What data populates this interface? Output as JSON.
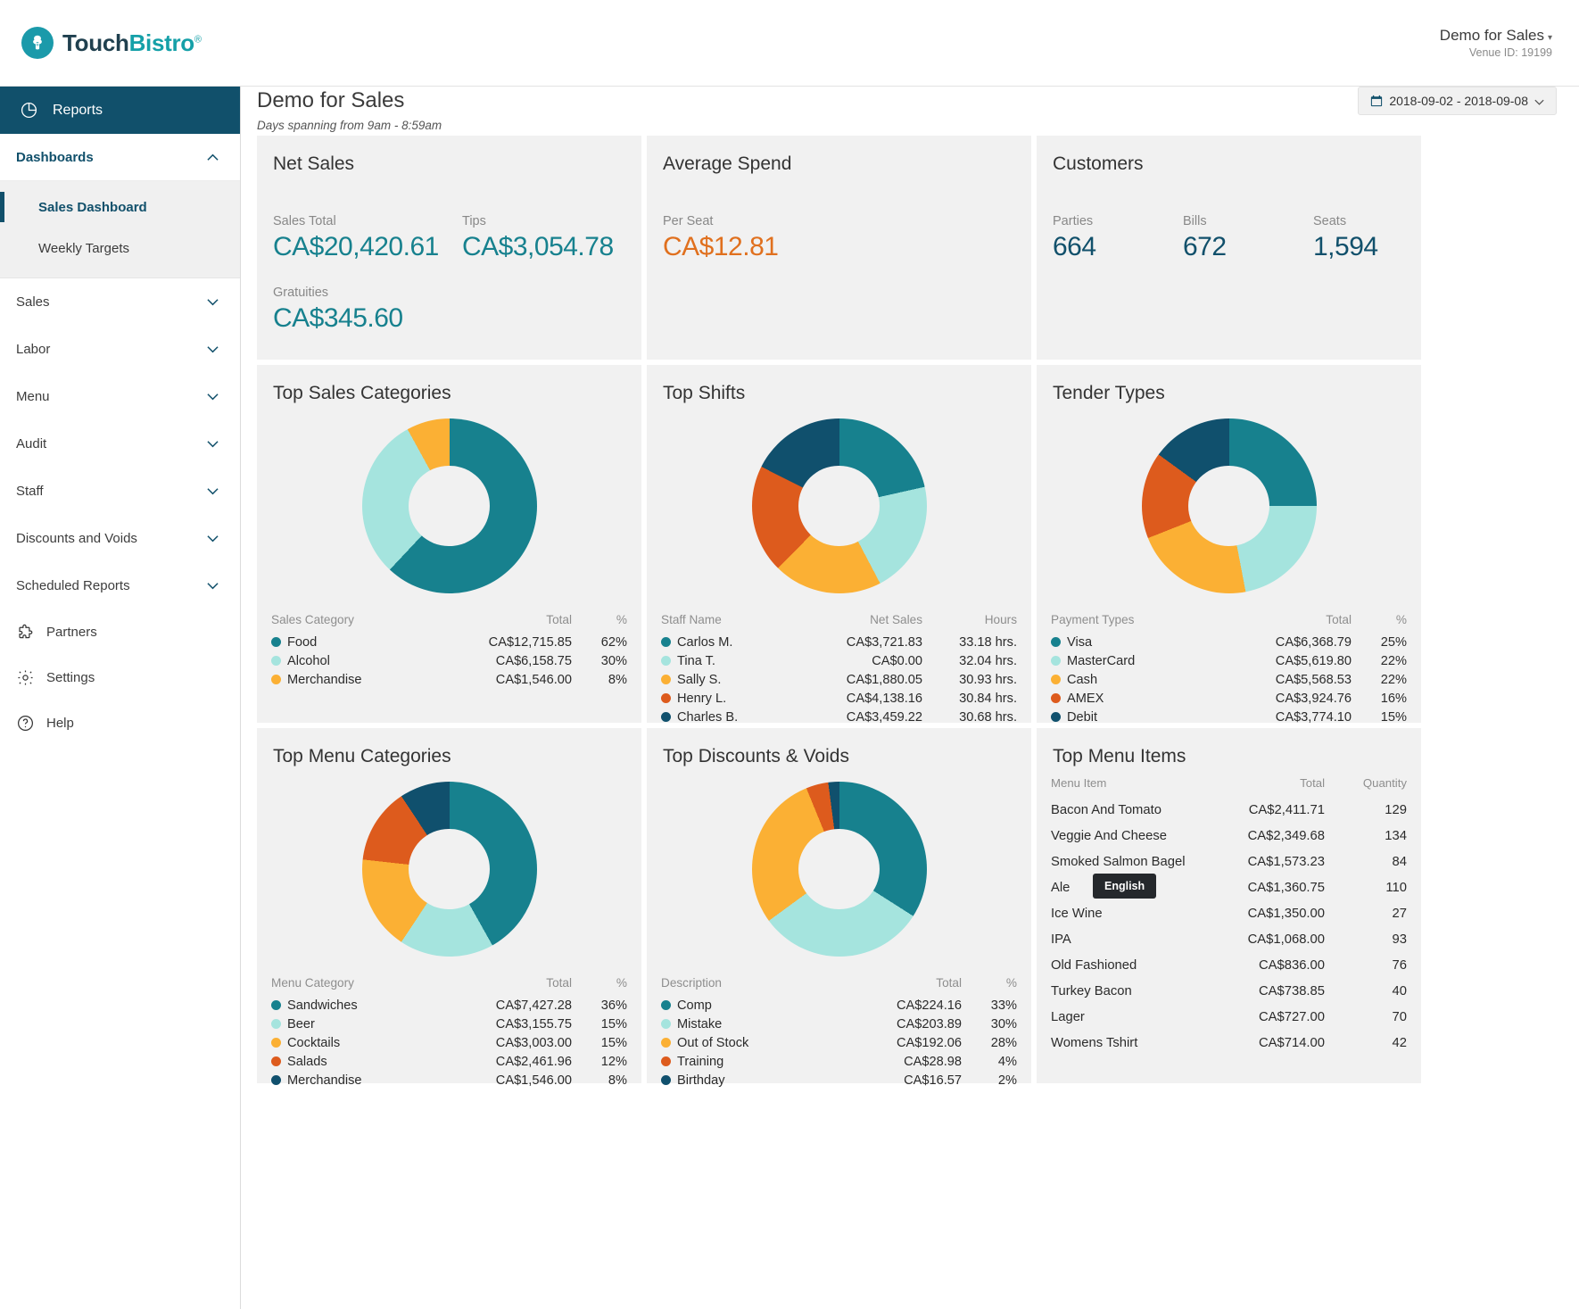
{
  "brand": {
    "name_part1": "Touch",
    "name_part2": "Bistro",
    "registered": "®",
    "logo_icon": "chef-hat-icon"
  },
  "header": {
    "venue_name": "Demo for Sales",
    "venue_caret": "▾",
    "venue_id": "Venue ID: 19199"
  },
  "sidebar": {
    "reports_label": "Reports",
    "reports_icon": "pie-chart-icon",
    "dashboards_label": "Dashboards",
    "dashboards_chevron": "⌃",
    "sub_items": [
      {
        "label": "Sales Dashboard",
        "active": true
      },
      {
        "label": "Weekly Targets",
        "active": false
      }
    ],
    "sections": [
      {
        "label": "Sales",
        "chevron": "⌄"
      },
      {
        "label": "Labor",
        "chevron": "⌄"
      },
      {
        "label": "Menu",
        "chevron": "⌄"
      },
      {
        "label": "Audit",
        "chevron": "⌄"
      },
      {
        "label": "Staff",
        "chevron": "⌄"
      },
      {
        "label": "Discounts and Voids",
        "chevron": "⌄"
      },
      {
        "label": "Scheduled Reports",
        "chevron": "⌄"
      }
    ],
    "utility": [
      {
        "label": "Partners",
        "icon": "puzzle-icon"
      },
      {
        "label": "Settings",
        "icon": "gear-icon"
      },
      {
        "label": "Help",
        "icon": "question-circle-icon"
      }
    ]
  },
  "page": {
    "title": "Demo for Sales",
    "subtitle": "Days spanning from 9am - 8:59am",
    "date_range": "2018-09-02 - 2018-09-08",
    "date_caret": "⌄",
    "calendar_icon": "calendar-icon"
  },
  "colors": {
    "teal": "#17818e",
    "light_cyan": "#a5e4de",
    "amber": "#fbb034",
    "orange": "#dd5b1d",
    "navy": "#10506d",
    "accent_orange_text": "#e0701e",
    "card_bg": "#f1f1f1",
    "sidebar_active": "#11506b"
  },
  "net_sales": {
    "title": "Net Sales",
    "sales_total_label": "Sales Total",
    "sales_total_value": "CA$20,420.61",
    "tips_label": "Tips",
    "tips_value": "CA$3,054.78",
    "gratuities_label": "Gratuities",
    "gratuities_value": "CA$345.60"
  },
  "average_spend": {
    "title": "Average Spend",
    "per_seat_label": "Per Seat",
    "per_seat_value": "CA$12.81"
  },
  "customers": {
    "title": "Customers",
    "parties_label": "Parties",
    "parties_value": "664",
    "bills_label": "Bills",
    "bills_value": "672",
    "seats_label": "Seats",
    "seats_value": "1,594"
  },
  "top_sales_categories": {
    "title": "Top Sales Categories",
    "headers": [
      "Sales Category",
      "Total",
      "%"
    ],
    "rows": [
      {
        "color": "#17818e",
        "label": "Food",
        "total": "CA$12,715.85",
        "pct": "62%"
      },
      {
        "color": "#a5e4de",
        "label": "Alcohol",
        "total": "CA$6,158.75",
        "pct": "30%"
      },
      {
        "color": "#fbb034",
        "label": "Merchandise",
        "total": "CA$1,546.00",
        "pct": "8%"
      }
    ]
  },
  "top_shifts": {
    "title": "Top Shifts",
    "headers": [
      "Staff Name",
      "Net Sales",
      "Hours"
    ],
    "rows": [
      {
        "color": "#17818e",
        "label": "Carlos M.",
        "total": "CA$3,721.83",
        "hours": "33.18 hrs."
      },
      {
        "color": "#a5e4de",
        "label": "Tina T.",
        "total": "CA$0.00",
        "hours": "32.04 hrs."
      },
      {
        "color": "#fbb034",
        "label": "Sally S.",
        "total": "CA$1,880.05",
        "hours": "30.93 hrs."
      },
      {
        "color": "#dd5b1d",
        "label": "Henry L.",
        "total": "CA$4,138.16",
        "hours": "30.84 hrs."
      },
      {
        "color": "#10506d",
        "label": "Charles B.",
        "total": "CA$3,459.22",
        "hours": "30.68 hrs."
      }
    ]
  },
  "tender_types": {
    "title": "Tender Types",
    "headers": [
      "Payment Types",
      "Total",
      "%"
    ],
    "rows": [
      {
        "color": "#17818e",
        "label": "Visa",
        "total": "CA$6,368.79",
        "pct": "25%"
      },
      {
        "color": "#a5e4de",
        "label": "MasterCard",
        "total": "CA$5,619.80",
        "pct": "22%"
      },
      {
        "color": "#fbb034",
        "label": "Cash",
        "total": "CA$5,568.53",
        "pct": "22%"
      },
      {
        "color": "#dd5b1d",
        "label": "AMEX",
        "total": "CA$3,924.76",
        "pct": "16%"
      },
      {
        "color": "#10506d",
        "label": "Debit",
        "total": "CA$3,774.10",
        "pct": "15%"
      }
    ]
  },
  "top_menu_categories": {
    "title": "Top Menu Categories",
    "headers": [
      "Menu Category",
      "Total",
      "%"
    ],
    "rows": [
      {
        "color": "#17818e",
        "label": "Sandwiches",
        "total": "CA$7,427.28",
        "pct": "36%"
      },
      {
        "color": "#a5e4de",
        "label": "Beer",
        "total": "CA$3,155.75",
        "pct": "15%"
      },
      {
        "color": "#fbb034",
        "label": "Cocktails",
        "total": "CA$3,003.00",
        "pct": "15%"
      },
      {
        "color": "#dd5b1d",
        "label": "Salads",
        "total": "CA$2,461.96",
        "pct": "12%"
      },
      {
        "color": "#10506d",
        "label": "Merchandise",
        "total": "CA$1,546.00",
        "pct": "8%"
      }
    ]
  },
  "top_discounts_voids": {
    "title": "Top Discounts & Voids",
    "headers": [
      "Description",
      "Total",
      "%"
    ],
    "rows": [
      {
        "color": "#17818e",
        "label": "Comp",
        "total": "CA$224.16",
        "pct": "33%"
      },
      {
        "color": "#a5e4de",
        "label": "Mistake",
        "total": "CA$203.89",
        "pct": "30%"
      },
      {
        "color": "#fbb034",
        "label": "Out of Stock",
        "total": "CA$192.06",
        "pct": "28%"
      },
      {
        "color": "#dd5b1d",
        "label": "Training",
        "total": "CA$28.98",
        "pct": "4%"
      },
      {
        "color": "#10506d",
        "label": "Birthday",
        "total": "CA$16.57",
        "pct": "2%"
      }
    ]
  },
  "top_menu_items": {
    "title": "Top Menu Items",
    "headers": [
      "Menu Item",
      "Total",
      "Quantity"
    ],
    "rows": [
      {
        "label": "Bacon And Tomato",
        "total": "CA$2,411.71",
        "qty": "129"
      },
      {
        "label": "Veggie And Cheese",
        "total": "CA$2,349.68",
        "qty": "134"
      },
      {
        "label": "Smoked Salmon Bagel",
        "total": "CA$1,573.23",
        "qty": "84"
      },
      {
        "label": "Ale",
        "total": "CA$1,360.75",
        "qty": "110"
      },
      {
        "label": "Ice Wine",
        "total": "CA$1,350.00",
        "qty": "27"
      },
      {
        "label": "IPA",
        "total": "CA$1,068.00",
        "qty": "93"
      },
      {
        "label": "Old Fashioned",
        "total": "CA$836.00",
        "qty": "76"
      },
      {
        "label": "Turkey Bacon",
        "total": "CA$738.85",
        "qty": "40"
      },
      {
        "label": "Lager",
        "total": "CA$727.00",
        "qty": "70"
      },
      {
        "label": "Womens Tshirt",
        "total": "CA$714.00",
        "qty": "42"
      }
    ]
  },
  "tooltip": {
    "text": "English"
  },
  "chart_data": [
    {
      "type": "pie",
      "title": "Top Sales Categories",
      "labels": [
        "Food",
        "Alcohol",
        "Merchandise"
      ],
      "values": [
        62,
        30,
        8
      ],
      "totals": [
        "CA$12,715.85",
        "CA$6,158.75",
        "CA$1,546.00"
      ],
      "colors": [
        "#17818e",
        "#a5e4de",
        "#fbb034"
      ],
      "legend": "table-below"
    },
    {
      "type": "pie",
      "title": "Top Shifts",
      "labels": [
        "Carlos M.",
        "Tina T.",
        "Sally S.",
        "Henry L.",
        "Charles B."
      ],
      "values": [
        21.5,
        20.8,
        20.1,
        20.0,
        17.6
      ],
      "totals": [
        "CA$3,721.83",
        "CA$0.00",
        "CA$1,880.05",
        "CA$4,138.16",
        "CA$3,459.22"
      ],
      "hours": [
        33.18,
        32.04,
        30.93,
        30.84,
        30.68
      ],
      "colors": [
        "#17818e",
        "#a5e4de",
        "#fbb034",
        "#dd5b1d",
        "#10506d"
      ],
      "legend": "table-below"
    },
    {
      "type": "pie",
      "title": "Tender Types",
      "labels": [
        "Visa",
        "MasterCard",
        "Cash",
        "AMEX",
        "Debit"
      ],
      "values": [
        25,
        22,
        22,
        16,
        15
      ],
      "totals": [
        "CA$6,368.79",
        "CA$5,619.80",
        "CA$5,568.53",
        "CA$3,924.76",
        "CA$3,774.10"
      ],
      "colors": [
        "#17818e",
        "#a5e4de",
        "#fbb034",
        "#dd5b1d",
        "#10506d"
      ],
      "legend": "table-below"
    },
    {
      "type": "pie",
      "title": "Top Menu Categories",
      "labels": [
        "Sandwiches",
        "Beer",
        "Cocktails",
        "Salads",
        "Merchandise"
      ],
      "values": [
        36,
        15,
        15,
        12,
        8
      ],
      "totals": [
        "CA$7,427.28",
        "CA$3,155.75",
        "CA$3,003.00",
        "CA$2,461.96",
        "CA$1,546.00"
      ],
      "colors": [
        "#17818e",
        "#a5e4de",
        "#fbb034",
        "#dd5b1d",
        "#10506d"
      ],
      "legend": "table-below"
    },
    {
      "type": "pie",
      "title": "Top Discounts & Voids",
      "labels": [
        "Comp",
        "Mistake",
        "Out of Stock",
        "Training",
        "Birthday"
      ],
      "values": [
        33,
        30,
        28,
        4,
        2
      ],
      "totals": [
        "CA$224.16",
        "CA$203.89",
        "CA$192.06",
        "CA$28.98",
        "CA$16.57"
      ],
      "colors": [
        "#17818e",
        "#a5e4de",
        "#fbb034",
        "#dd5b1d",
        "#10506d"
      ],
      "legend": "table-below"
    }
  ]
}
